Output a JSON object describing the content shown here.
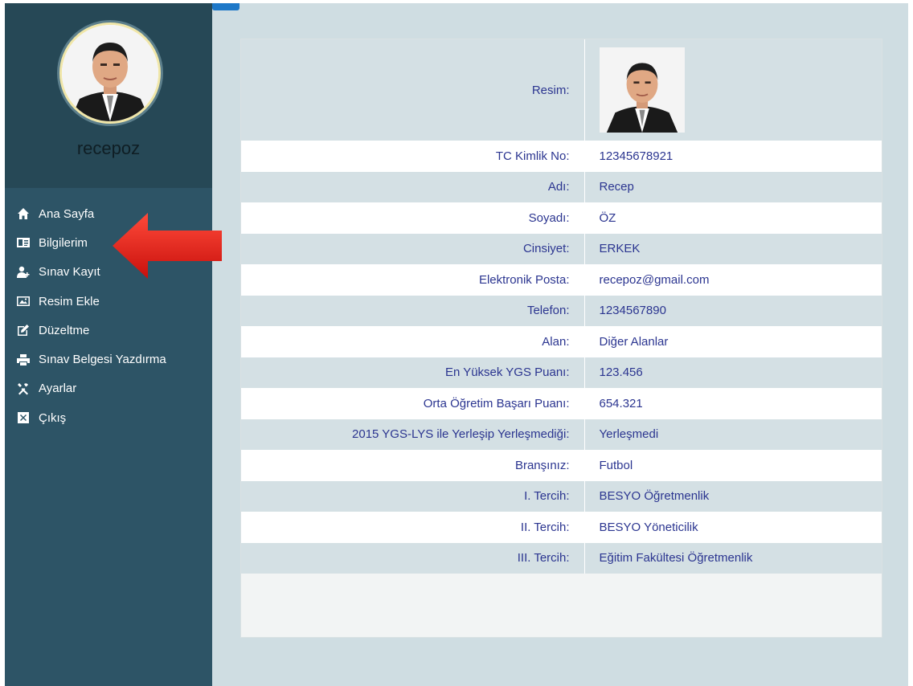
{
  "sidebar": {
    "username": "recepoz",
    "menu": [
      {
        "label": "Ana Sayfa",
        "icon": "home-icon"
      },
      {
        "label": "Bilgilerim",
        "icon": "id-card-icon"
      },
      {
        "label": "Sınav Kayıt",
        "icon": "user-plus-icon"
      },
      {
        "label": "Resim Ekle",
        "icon": "picture-icon"
      },
      {
        "label": "Düzeltme",
        "icon": "edit-icon"
      },
      {
        "label": "Sınav Belgesi Yazdırma",
        "icon": "printer-icon"
      },
      {
        "label": "Ayarlar",
        "icon": "tools-icon"
      },
      {
        "label": "Çıkış",
        "icon": "close-box-icon"
      }
    ]
  },
  "details": {
    "photo_label": "Resim:",
    "rows": [
      {
        "label": "TC Kimlik No:",
        "value": "12345678921"
      },
      {
        "label": "Adı:",
        "value": "Recep"
      },
      {
        "label": "Soyadı:",
        "value": "ÖZ"
      },
      {
        "label": "Cinsiyet:",
        "value": "ERKEK"
      },
      {
        "label": "Elektronik Posta:",
        "value": "recepoz@gmail.com"
      },
      {
        "label": "Telefon:",
        "value": "1234567890"
      },
      {
        "label": "Alan:",
        "value": "Diğer Alanlar"
      },
      {
        "label": "En Yüksek YGS Puanı:",
        "value": "123.456"
      },
      {
        "label": "Orta Öğretim Başarı Puanı:",
        "value": "654.321"
      },
      {
        "label": "2015 YGS-LYS ile Yerleşip Yerleşmediği:",
        "value": "Yerleşmedi"
      },
      {
        "label": "Branşınız:",
        "value": "Futbol"
      },
      {
        "label": "I. Tercih:",
        "value": "BESYO Öğretmenlik"
      },
      {
        "label": "II. Tercih:",
        "value": "BESYO Yöneticilik"
      },
      {
        "label": "III. Tercih:",
        "value": "Eğitim Fakültesi Öğretmenlik"
      }
    ]
  },
  "colors": {
    "sidebar_bg": "#2d5466",
    "content_bg": "#cfdde2",
    "text_blue": "#2b3590",
    "arrow_red": "#e0201e"
  }
}
